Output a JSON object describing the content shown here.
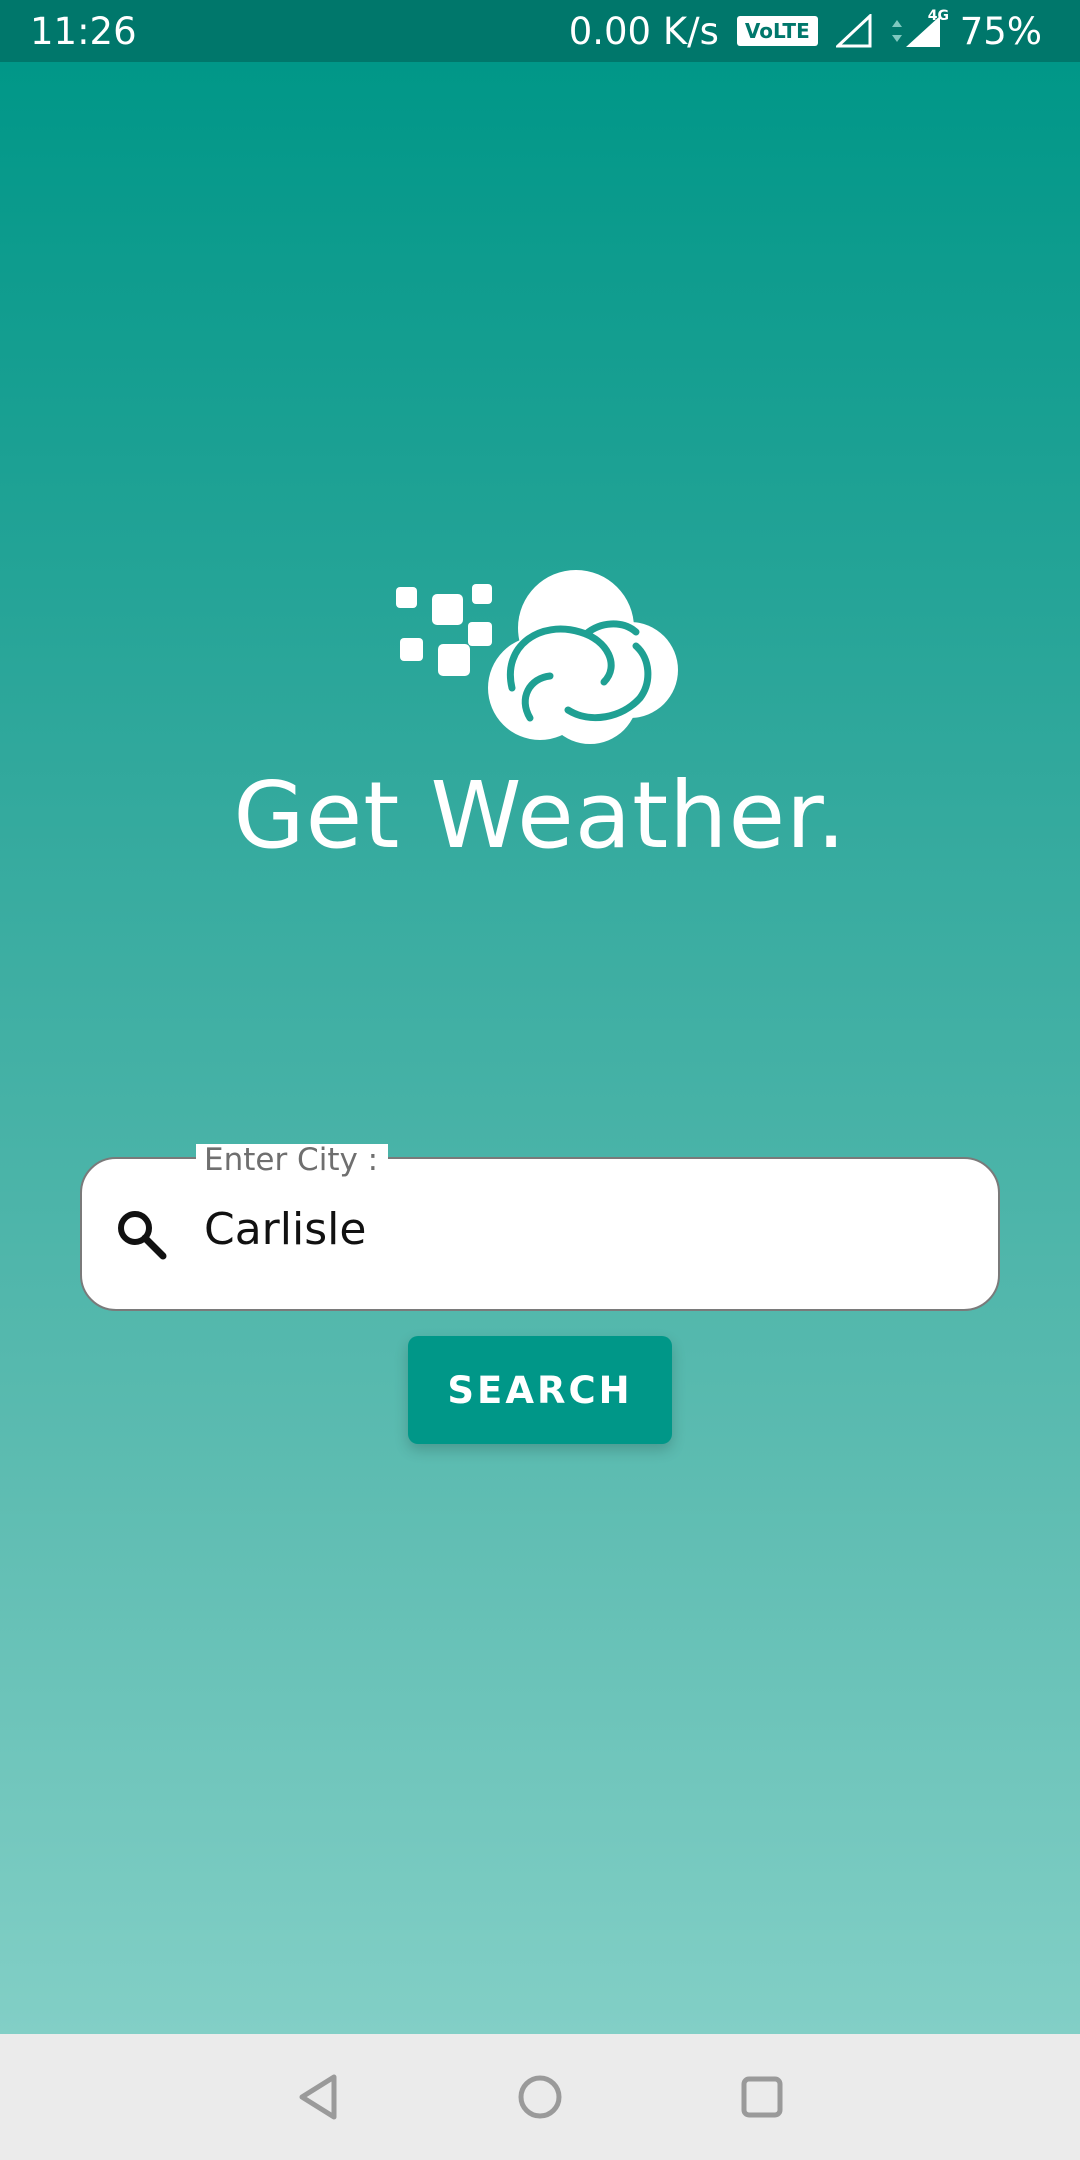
{
  "status_bar": {
    "time": "11:26",
    "net_speed": "0.00 K/s",
    "volte": "VoLTE",
    "network_type": "4G",
    "battery": "75%"
  },
  "app": {
    "title": "Get Weather.",
    "logo_icon": "cloud-logo-icon"
  },
  "search": {
    "label": "Enter City :",
    "value": "Carlisle",
    "icon": "search-icon",
    "button_label": "SEARCH"
  },
  "nav_bar": {
    "back_icon": "back-triangle-icon",
    "home_icon": "home-circle-icon",
    "recents_icon": "recents-square-icon"
  },
  "colors": {
    "status_bar": "#00776b",
    "accent": "#009788",
    "gradient_top": "#009788",
    "gradient_bottom": "#82cfc6",
    "nav_bar": "#ebebeb"
  }
}
